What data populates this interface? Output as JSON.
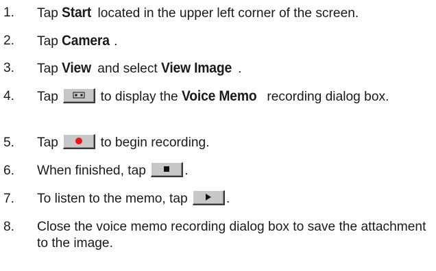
{
  "steps": [
    {
      "num": "1.",
      "t1": "Tap ",
      "kw1": "Start",
      "t2": " located in the upper left corner of the screen."
    },
    {
      "num": "2.",
      "t1": "Tap ",
      "kw1": "Camera",
      "t2": "."
    },
    {
      "num": "3.",
      "t1": "Tap ",
      "kw1": "View",
      "t2": " and select ",
      "kw2": "View Image",
      "t3": "."
    },
    {
      "num": "4.",
      "t1": "Tap ",
      "icon": "voice-memo-tape-icon",
      "t2": " to display the ",
      "kw1": "Voice Memo",
      "t3": " recording dialog box."
    },
    {
      "num": "5.",
      "t1": "Tap ",
      "icon": "record-icon",
      "t2": " to begin recording."
    },
    {
      "num": "6.",
      "t1": "When finished, tap ",
      "icon": "stop-icon",
      "t2": "."
    },
    {
      "num": "7.",
      "t1": "To listen to the memo, tap ",
      "icon": "play-icon",
      "t2": "."
    },
    {
      "num": "8.",
      "t1": "Close the voice memo recording dialog box to save the attachment to the image."
    }
  ],
  "colors": {
    "record": "#e8141c",
    "button_face": "#c8c8c8",
    "text": "#1a1a1a"
  }
}
